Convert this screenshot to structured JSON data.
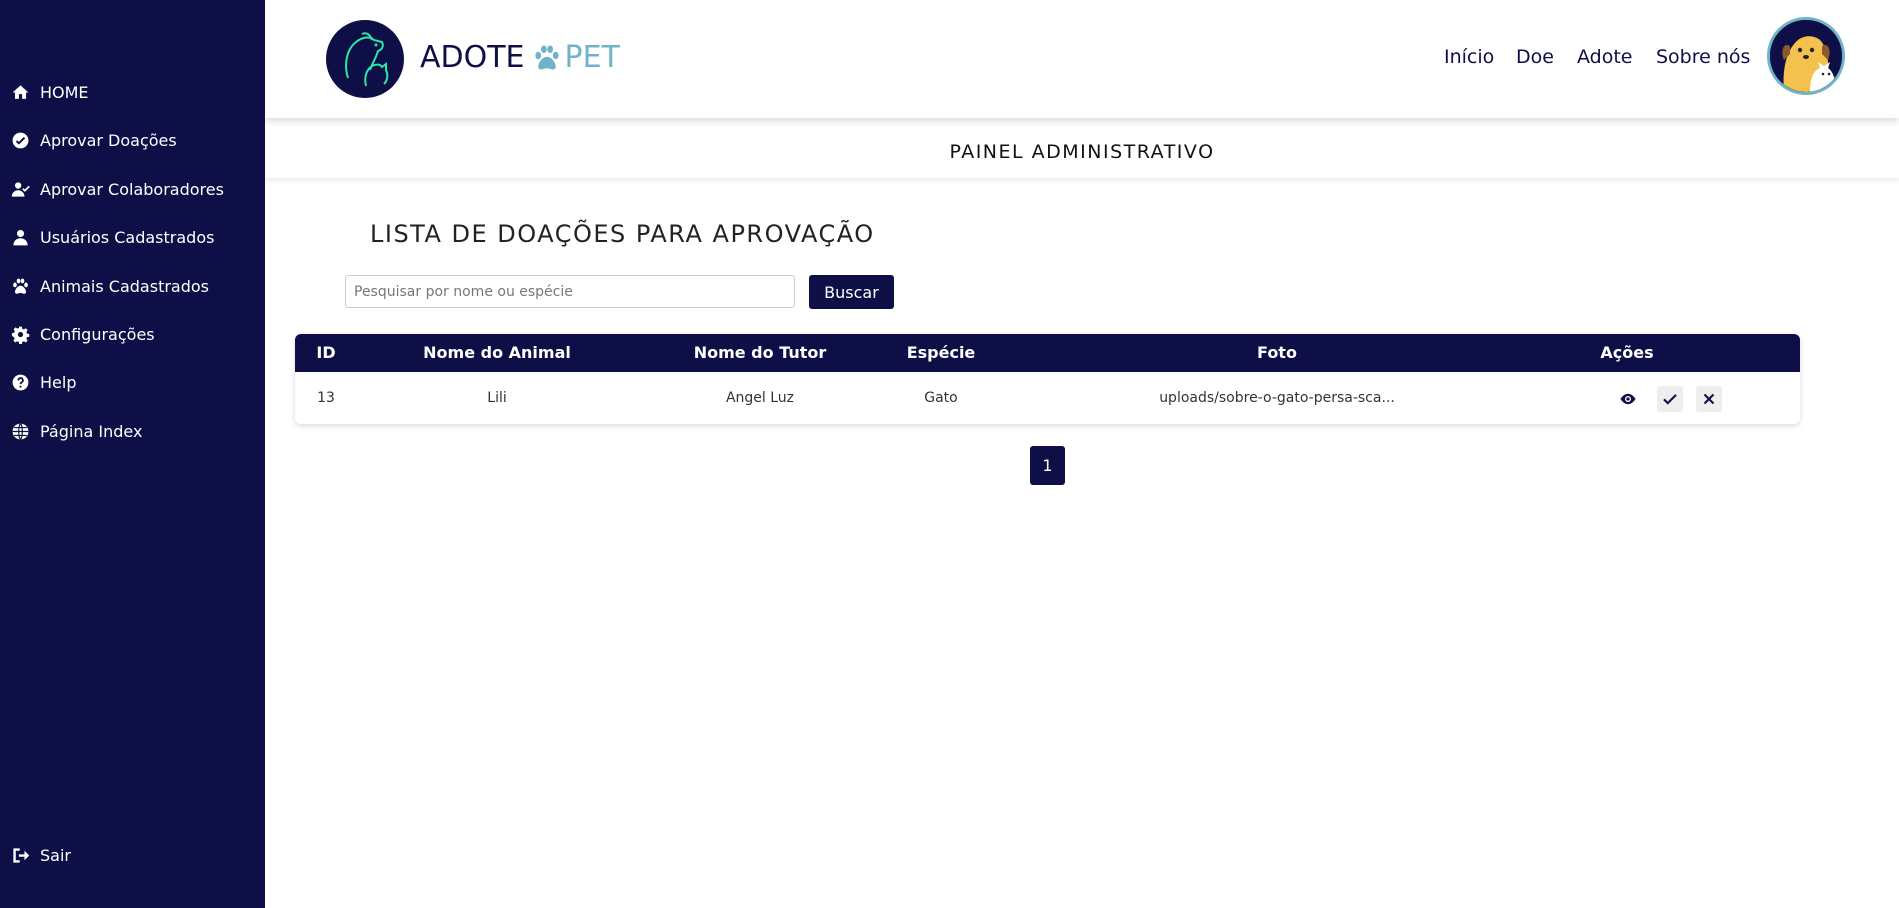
{
  "sidebar": {
    "items": [
      {
        "label": "HOME",
        "icon": "home-icon"
      },
      {
        "label": "Aprovar Doações",
        "icon": "check-circle-icon"
      },
      {
        "label": "Aprovar Colaboradores",
        "icon": "user-check-icon"
      },
      {
        "label": "Usuários Cadastrados",
        "icon": "user-icon"
      },
      {
        "label": "Animais Cadastrados",
        "icon": "paw-icon"
      },
      {
        "label": "Configurações",
        "icon": "gear-icon"
      },
      {
        "label": "Help",
        "icon": "question-circle-icon"
      },
      {
        "label": "Página Index",
        "icon": "globe-icon"
      }
    ],
    "logout": {
      "label": "Sair",
      "icon": "sign-out-icon"
    }
  },
  "header": {
    "brand_part1": "ADOTE",
    "brand_part2": "PET",
    "nav": [
      "Início",
      "Doe",
      "Adote",
      "Sobre nós"
    ]
  },
  "subheader": {
    "title": "PAINEL ADMINISTRATIVO"
  },
  "main": {
    "title": "LISTA DE DOAÇÕES PARA APROVAÇÃO",
    "search": {
      "placeholder": "Pesquisar por nome ou espécie",
      "value": "",
      "button": "Buscar"
    },
    "table": {
      "columns": [
        "ID",
        "Nome do Animal",
        "Nome do Tutor",
        "Espécie",
        "Foto",
        "Ações"
      ],
      "rows": [
        {
          "id": "13",
          "animal": "Lili",
          "tutor": "Angel Luz",
          "especie": "Gato",
          "foto": "uploads/sobre-o-gato-persa-sca..."
        }
      ]
    },
    "pagination": {
      "pages": [
        "1"
      ],
      "current": "1"
    }
  },
  "colors": {
    "primary": "#0f0f48",
    "accent": "#6fb3c8",
    "background": "#ffffff"
  }
}
